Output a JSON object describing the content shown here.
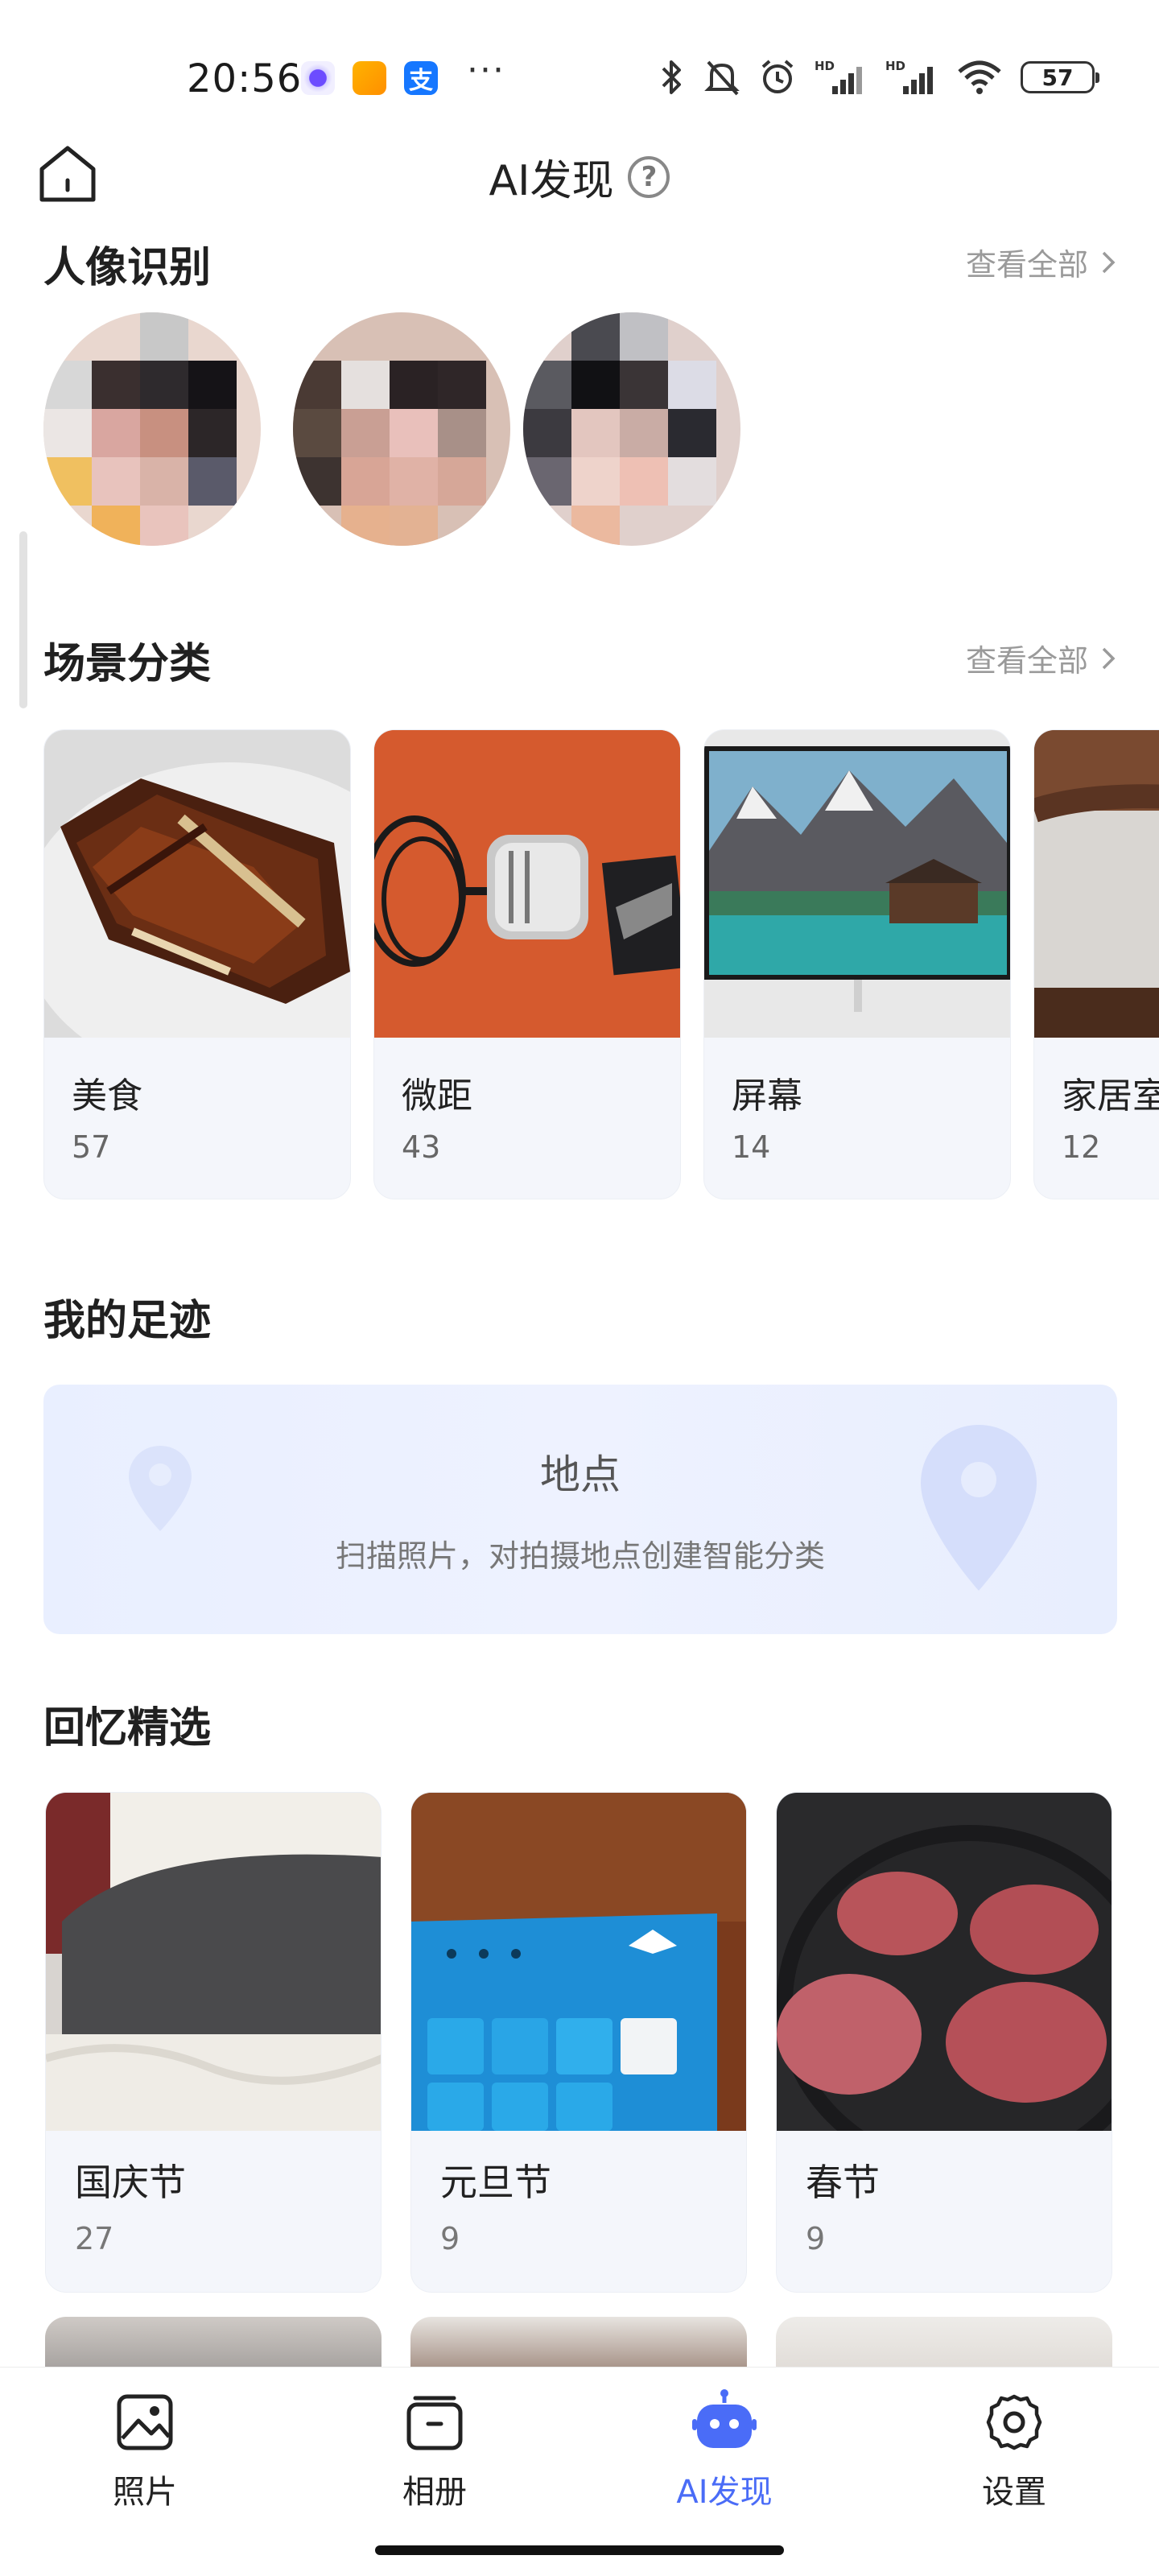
{
  "status_bar": {
    "time": "20:56",
    "battery": "57",
    "icons": [
      "bluetooth-icon",
      "mute-icon",
      "alarm-icon",
      "hd-signal-icon",
      "hd-signal-icon",
      "wifi-icon"
    ]
  },
  "header": {
    "title": "AI发现",
    "help": "?"
  },
  "portrait": {
    "title": "人像识别",
    "see_all": "查看全部"
  },
  "scenes": {
    "title": "场景分类",
    "see_all": "查看全部",
    "items": [
      {
        "name": "美食",
        "count": "57"
      },
      {
        "name": "微距",
        "count": "43"
      },
      {
        "name": "屏幕",
        "count": "14"
      },
      {
        "name": "家居室",
        "count": "12"
      }
    ]
  },
  "footprint": {
    "title": "我的足迹",
    "card_title": "地点",
    "card_subtitle": "扫描照片，对拍摄地点创建智能分类"
  },
  "memories": {
    "title": "回忆精选",
    "items": [
      {
        "name": "国庆节",
        "count": "27"
      },
      {
        "name": "元旦节",
        "count": "9"
      },
      {
        "name": "春节",
        "count": "9"
      }
    ]
  },
  "nav": {
    "items": [
      {
        "label": "照片",
        "icon": "photo-icon"
      },
      {
        "label": "相册",
        "icon": "album-icon"
      },
      {
        "label": "AI发现",
        "icon": "robot-icon",
        "active": true
      },
      {
        "label": "设置",
        "icon": "gear-icon"
      }
    ]
  },
  "colors": {
    "accent": "#4a6cf7",
    "card_bg": "#f4f6fb",
    "muted_text": "#9a9a9a"
  }
}
